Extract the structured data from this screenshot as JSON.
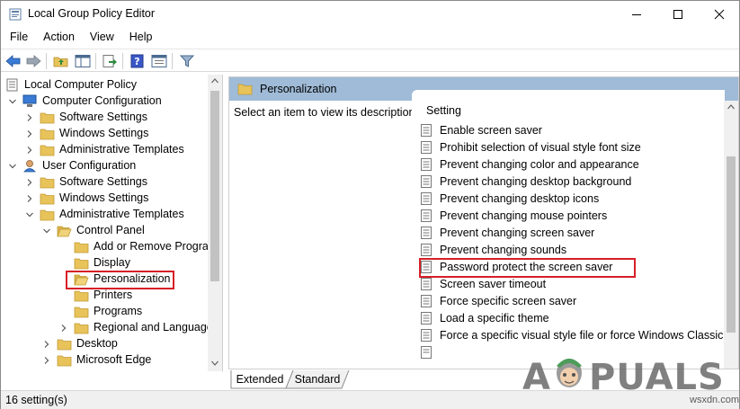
{
  "window": {
    "title": "Local Group Policy Editor"
  },
  "menu": [
    "File",
    "Action",
    "View",
    "Help"
  ],
  "tree": {
    "items": [
      {
        "label": "Local Computer Policy",
        "icon": "policy-icon"
      },
      {
        "label": "Computer Configuration",
        "icon": "computer-icon"
      },
      {
        "label": "Software Settings",
        "icon": "folder-icon"
      },
      {
        "label": "Windows Settings",
        "icon": "folder-icon"
      },
      {
        "label": "Administrative Templates",
        "icon": "folder-icon"
      },
      {
        "label": "User Configuration",
        "icon": "user-icon"
      },
      {
        "label": "Software Settings",
        "icon": "folder-icon"
      },
      {
        "label": "Windows Settings",
        "icon": "folder-icon"
      },
      {
        "label": "Administrative Templates",
        "icon": "folder-icon"
      },
      {
        "label": "Control Panel",
        "icon": "folder-icon"
      },
      {
        "label": "Add or Remove Program",
        "icon": "folder-icon"
      },
      {
        "label": "Display",
        "icon": "folder-icon"
      },
      {
        "label": "Personalization",
        "icon": "folder-icon"
      },
      {
        "label": "Printers",
        "icon": "folder-icon"
      },
      {
        "label": "Programs",
        "icon": "folder-icon"
      },
      {
        "label": "Regional and Language",
        "icon": "folder-icon"
      },
      {
        "label": "Desktop",
        "icon": "folder-icon"
      },
      {
        "label": "Microsoft Edge",
        "icon": "folder-icon"
      }
    ]
  },
  "right": {
    "header": "Personalization",
    "description": "Select an item to view its description.",
    "column": "Setting",
    "settings": [
      "Enable screen saver",
      "Prohibit selection of visual style font size",
      "Prevent changing color and appearance",
      "Prevent changing desktop background",
      "Prevent changing desktop icons",
      "Prevent changing mouse pointers",
      "Prevent changing screen saver",
      "Prevent changing sounds",
      "Password protect the screen saver",
      "Screen saver timeout",
      "Force specific screen saver",
      "Load a specific theme",
      "Force a specific visual style file or force Windows Classic"
    ]
  },
  "tabs": [
    "Extended",
    "Standard"
  ],
  "status": "16 setting(s)",
  "watermark": {
    "brand": "PUALS",
    "site": "wsxdn.com"
  },
  "colors": {
    "header_bg": "#9fbbd7",
    "highlight": "#d61f26",
    "folder": "#e8c35a"
  }
}
